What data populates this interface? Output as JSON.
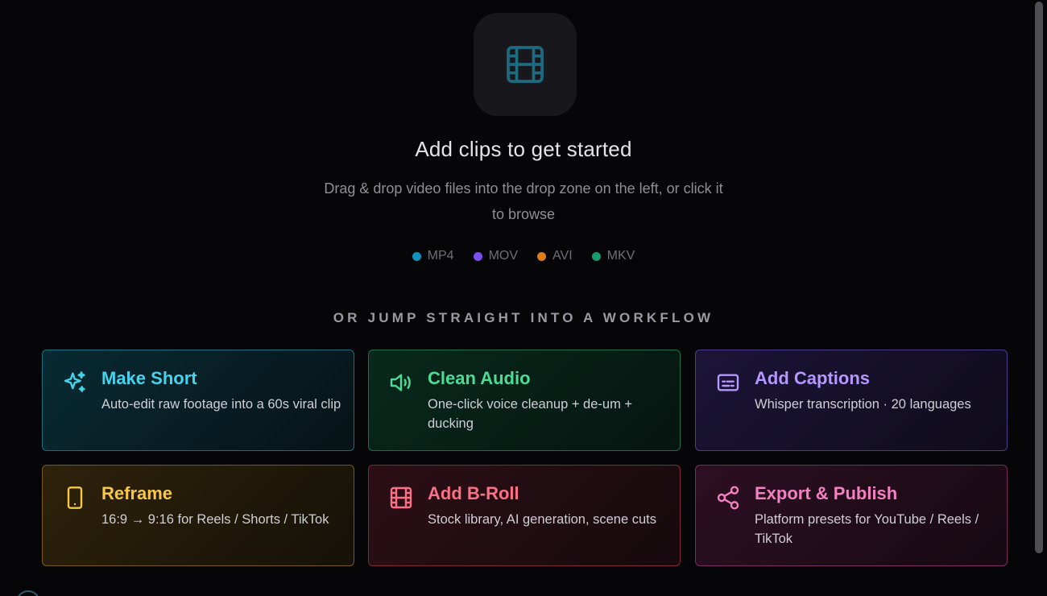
{
  "hero": {
    "icon": "film-icon",
    "title": "Add clips to get started",
    "subtitle": "Drag & drop video files into the drop zone on the left, or click it to browse"
  },
  "formats": [
    {
      "label": "MP4",
      "color": "#1392bd"
    },
    {
      "label": "MOV",
      "color": "#7c4ff0"
    },
    {
      "label": "AVI",
      "color": "#e07c14"
    },
    {
      "label": "MKV",
      "color": "#149a6e"
    }
  ],
  "workflow": {
    "heading": "OR JUMP STRAIGHT INTO A WORKFLOW",
    "cards": [
      {
        "title": "Make Short",
        "desc": "Auto-edit raw footage into a 60s viral clip",
        "icon": "sparkles-icon",
        "accent": "#45d4ec"
      },
      {
        "title": "Clean Audio",
        "desc": "One-click voice cleanup + de-um + ducking",
        "icon": "speaker-icon",
        "accent": "#4edb98"
      },
      {
        "title": "Add Captions",
        "desc": "Whisper transcription · 20 languages",
        "icon": "captions-icon",
        "accent": "#b696ff"
      },
      {
        "title": "Reframe",
        "desc": "16:9 → 9:16 for Reels / Shorts / TikTok",
        "icon": "phone-icon",
        "accent": "#f8c744"
      },
      {
        "title": "Add B-Roll",
        "desc": "Stock library, AI generation, scene cuts",
        "icon": "film-icon",
        "accent": "#fb7085"
      },
      {
        "title": "Export & Publish",
        "desc": "Platform presets for YouTube / Reels / TikTok",
        "icon": "share-icon",
        "accent": "#f380c0"
      }
    ]
  }
}
